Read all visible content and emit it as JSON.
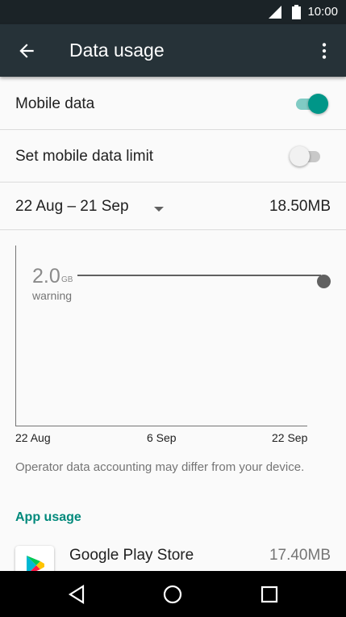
{
  "status_bar": {
    "time": "10:00"
  },
  "app_bar": {
    "title": "Data usage"
  },
  "mobile_data": {
    "label": "Mobile data",
    "enabled": true
  },
  "data_limit": {
    "label": "Set mobile data limit",
    "enabled": false
  },
  "billing_cycle": {
    "range": "22 Aug – 21 Sep",
    "amount": "18.50MB"
  },
  "chart": {
    "warning_value": "2.0",
    "warning_unit": "GB",
    "warning_label": "warning",
    "x_ticks": [
      "22 Aug",
      "6 Sep",
      "22 Sep"
    ]
  },
  "note": "Operator data accounting may differ from your device.",
  "app_usage": {
    "heading": "App usage",
    "items": [
      {
        "name": "Google Play Store",
        "amount": "17.40MB"
      }
    ]
  },
  "colors": {
    "accent": "#009688",
    "app_bar": "#263238",
    "status_bar": "#1b2327"
  }
}
